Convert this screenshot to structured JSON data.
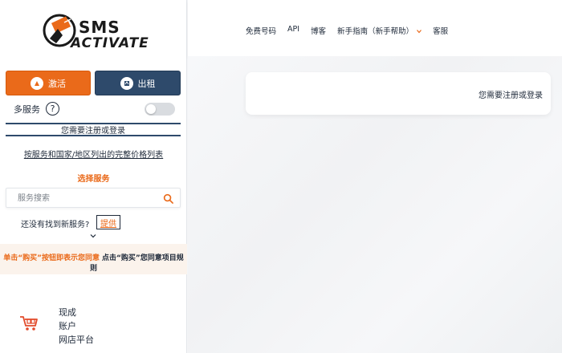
{
  "logo": {
    "line1": "SMS",
    "line2": "ACTIVATE"
  },
  "sidebar": {
    "activate_label": "激活",
    "rent_label": "出租",
    "multi_service_label": "多服务",
    "help_label": "?",
    "login_notice": "您需要注册或登录",
    "price_list_link": "按服务和国家/地区列出的完整价格列表",
    "choose_service": "选择服务",
    "search_placeholder": "服务搜索",
    "not_found": "还没有找到新服务?",
    "provide_link": "提供",
    "agree_orange": "单击“购买”按钮即表示您同意",
    "agree_dark": "点击“购买”您同意项目规则",
    "shop_lines": [
      "现成",
      "账户",
      "网店平台"
    ]
  },
  "header": {
    "nav": [
      "免费号码",
      "API",
      "博客",
      "新手指南（新手帮助）",
      "客服"
    ]
  },
  "main": {
    "card_text": "您需要注册或登录"
  },
  "colors": {
    "accent": "#ea6a1a",
    "navy": "#2e4a6b"
  }
}
